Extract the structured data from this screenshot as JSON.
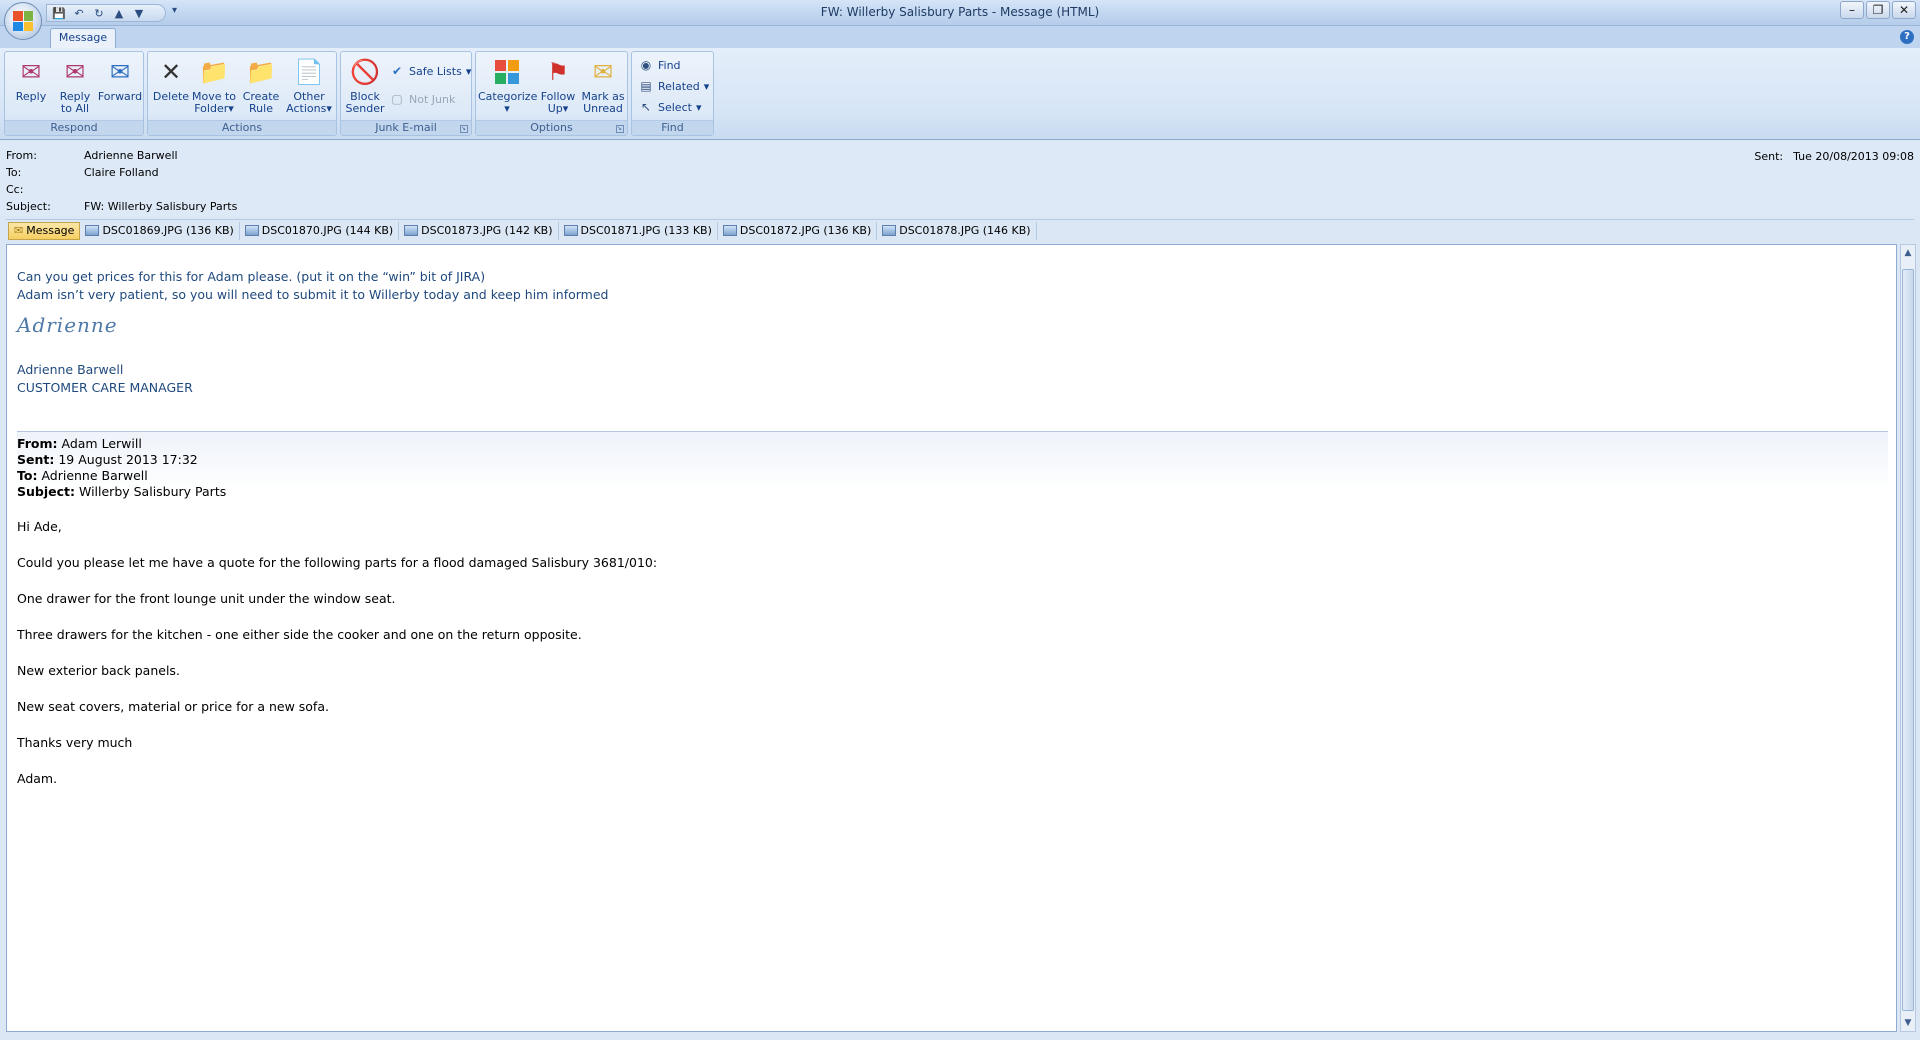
{
  "window": {
    "title": "FW: Willerby Salisbury Parts - Message (HTML)",
    "controls": [
      "minimize",
      "restore",
      "close"
    ]
  },
  "ribbon": {
    "tab": "Message",
    "groups": {
      "respond": {
        "label": "Respond",
        "reply": "Reply",
        "reply_all_1": "Reply",
        "reply_all_2": "to All",
        "forward": "Forward"
      },
      "actions": {
        "label": "Actions",
        "delete": "Delete",
        "move_1": "Move to",
        "move_2": "Folder",
        "rule_1": "Create",
        "rule_2": "Rule",
        "other_1": "Other",
        "other_2": "Actions"
      },
      "junk": {
        "label": "Junk E-mail",
        "block_1": "Block",
        "block_2": "Sender",
        "safe_lists": "Safe Lists",
        "not_junk": "Not Junk"
      },
      "options": {
        "label": "Options",
        "categorize": "Categorize",
        "follow_1": "Follow",
        "follow_2": "Up",
        "mark_1": "Mark as",
        "mark_2": "Unread"
      },
      "find": {
        "label": "Find",
        "find": "Find",
        "related": "Related",
        "select": "Select"
      }
    }
  },
  "header": {
    "from_label": "From:",
    "from": "Adrienne Barwell",
    "to_label": "To:",
    "to": "Claire Folland",
    "cc_label": "Cc:",
    "cc": "",
    "subject_label": "Subject:",
    "subject": "FW: Willerby Salisbury Parts",
    "sent_label": "Sent:",
    "sent": "Tue 20/08/2013 09:08"
  },
  "attachments": [
    {
      "name": "Message"
    },
    {
      "name": "DSC01869.JPG (136 KB)"
    },
    {
      "name": "DSC01870.JPG (144 KB)"
    },
    {
      "name": "DSC01873.JPG (142 KB)"
    },
    {
      "name": "DSC01871.JPG (133 KB)"
    },
    {
      "name": "DSC01872.JPG (136 KB)"
    },
    {
      "name": "DSC01878.JPG (146 KB)"
    }
  ],
  "body": {
    "line1": "Can you get prices for this for Adam please.  (put it on the “win” bit of JIRA)",
    "line2": "Adam isn’t very patient, so you will need to submit it to Willerby today and keep him informed",
    "signature_script": "Adrienne",
    "sig_name": "Adrienne Barwell",
    "sig_title": "CUSTOMER CARE MANAGER",
    "fwd": {
      "from_label": "From:",
      "from": "Adam Lerwill",
      "sent_label": "Sent:",
      "sent": "19 August 2013 17:32",
      "to_label": "To:",
      "to": "Adrienne Barwell",
      "subject_label": "Subject:",
      "subject": "Willerby Salisbury Parts"
    },
    "paragraphs": [
      "Hi Ade,",
      "Could you please let me have a quote for the following parts for a flood damaged Salisbury 3681/010:",
      "One drawer for the front lounge unit under the window seat.",
      "Three drawers for the kitchen -  one either side the cooker and one on the return opposite.",
      "New exterior back panels.",
      "New seat covers, material or price for a new sofa.",
      "Thanks very much",
      "Adam."
    ]
  }
}
